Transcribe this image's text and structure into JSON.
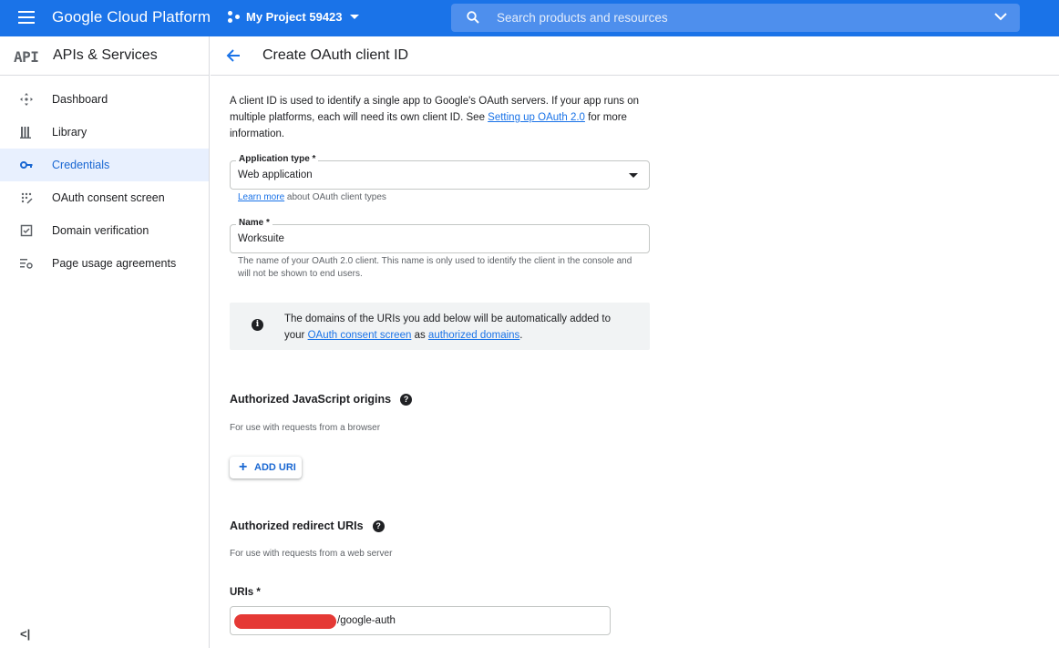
{
  "topbar": {
    "brand": "Google Cloud Platform",
    "project": "My Project 59423",
    "search_placeholder": "Search products and resources"
  },
  "sidebar": {
    "api_badge": "API",
    "title": "APIs & Services",
    "items": [
      {
        "label": "Dashboard",
        "icon": "dashboard-icon",
        "active": false
      },
      {
        "label": "Library",
        "icon": "library-icon",
        "active": false
      },
      {
        "label": "Credentials",
        "icon": "key-icon",
        "active": true
      },
      {
        "label": "OAuth consent screen",
        "icon": "consent-grid-icon",
        "active": false
      },
      {
        "label": "Domain verification",
        "icon": "checkbox-icon",
        "active": false
      },
      {
        "label": "Page usage agreements",
        "icon": "settings-list-icon",
        "active": false
      }
    ],
    "collapse_label": "<|"
  },
  "main": {
    "title": "Create OAuth client ID",
    "intro_text": "A client ID is used to identify a single app to Google's OAuth servers. If your app runs on multiple platforms, each will need its own client ID. See ",
    "intro_link": "Setting up OAuth 2.0",
    "intro_after": " for more information.",
    "app_type": {
      "label": "Application type *",
      "value": "Web application",
      "hint_link": "Learn more",
      "hint_text": " about OAuth client types"
    },
    "name": {
      "label": "Name *",
      "value": "Worksuite",
      "hint": "The name of your OAuth 2.0 client. This name is only used to identify the client in the console and will not be shown to end users."
    },
    "info": {
      "text_before": "The domains of the URIs you add below will be automatically added to your ",
      "link1": "OAuth consent screen",
      "text_mid": " as ",
      "link2": "authorized domains",
      "text_after": "."
    },
    "js_origins": {
      "title": "Authorized JavaScript origins",
      "subtitle": "For use with requests from a browser",
      "add_button": "ADD URI"
    },
    "redirect_uris": {
      "title": "Authorized redirect URIs",
      "subtitle": "For use with requests from a web server",
      "uris_label": "URIs *",
      "uri_value": "/google-auth"
    }
  },
  "colors": {
    "brand_blue": "#1a73e8",
    "active_bg": "#e8f0fe",
    "active_text": "#1967d2",
    "redaction": "#e53935"
  }
}
